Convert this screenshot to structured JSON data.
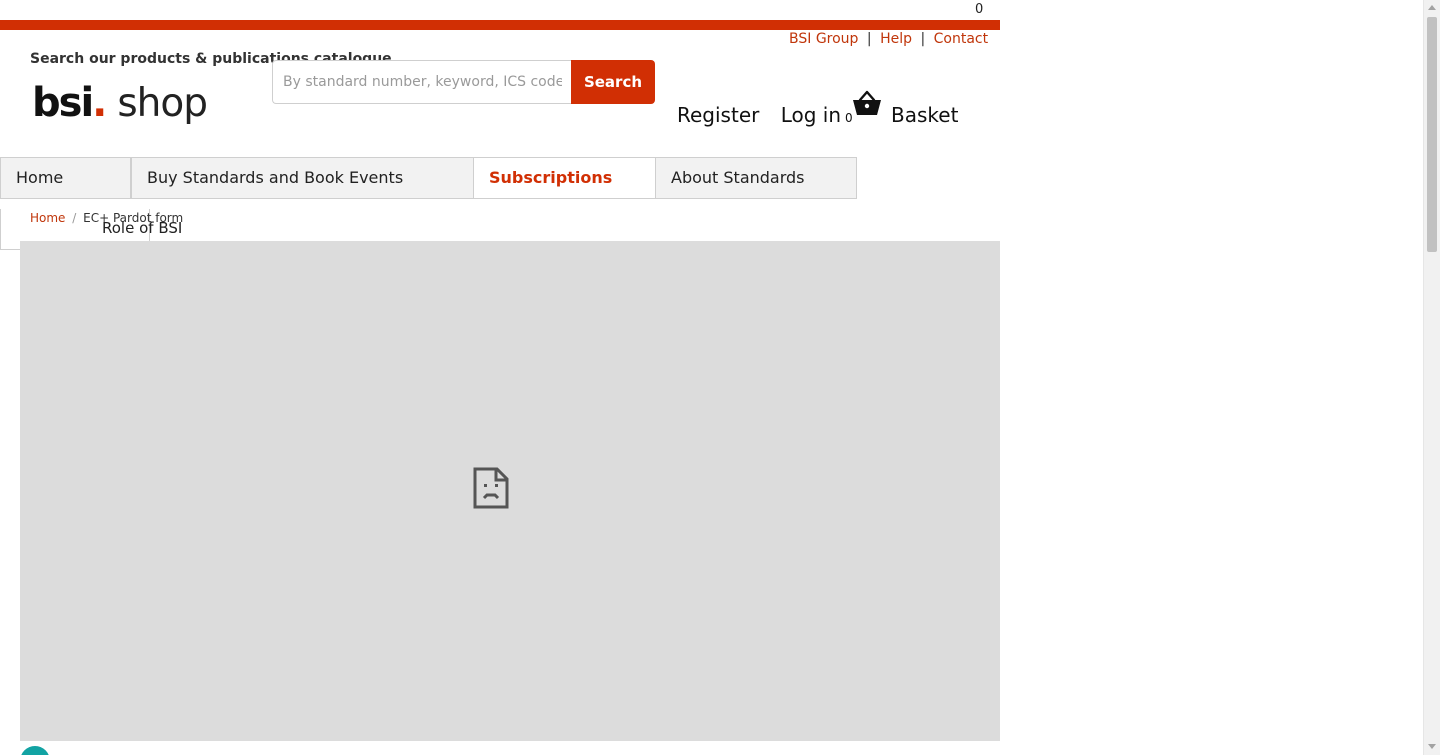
{
  "top_counter": "0",
  "util_links": {
    "group": "BSI Group",
    "help": "Help",
    "contact": "Contact",
    "separator": "|"
  },
  "header": {
    "search_heading": "Search our products & publications catalogue",
    "logo_bsi": "bsi",
    "logo_dot": ".",
    "logo_shop": "shop",
    "search_placeholder": "By standard number, keyword, ICS code, IS",
    "search_button": "Search"
  },
  "account": {
    "register": "Register",
    "login": "Log in",
    "login_count": "0",
    "basket": "Basket"
  },
  "nav": {
    "items": [
      {
        "label": "Home"
      },
      {
        "label": "Buy Standards and Book Events"
      },
      {
        "label": "Subscriptions",
        "active": true
      },
      {
        "label": "About Standards"
      }
    ]
  },
  "sub_nav": {
    "label": "Role of BSI"
  },
  "breadcrumb": {
    "home": "Home",
    "separator": "/",
    "current": "EC+ Pardot form"
  },
  "content": {
    "embedded_frame_status": "sad-page-icon"
  },
  "colors": {
    "brand_red": "#d12f04",
    "link_red": "#c0360b",
    "frame_grey": "#dcdcdc",
    "chat_teal": "#12a3a3"
  }
}
